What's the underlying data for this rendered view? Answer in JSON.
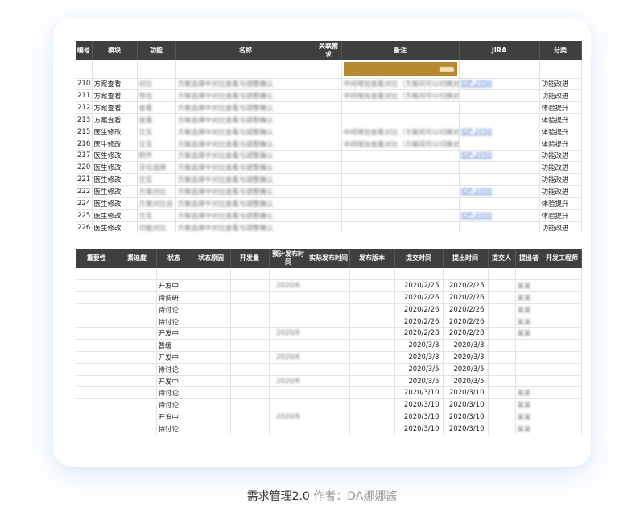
{
  "caption": {
    "title": "需求管理2.0",
    "author": "作者：DA娜娜酱"
  },
  "table1": {
    "headers": [
      "编号",
      "模块",
      "功能",
      "名称",
      "关联需\n求",
      "备注",
      "JIRA",
      "分类"
    ],
    "rows": [
      {
        "id": "210",
        "module": "方案查看",
        "category": "功能改进"
      },
      {
        "id": "211",
        "module": "方案查看",
        "category": "功能改进"
      },
      {
        "id": "212",
        "module": "方案查看",
        "category": "体验提升"
      },
      {
        "id": "213",
        "module": "方案查看",
        "category": "体验提升"
      },
      {
        "id": "215",
        "module": "医生修改",
        "category": "体验提升"
      },
      {
        "id": "216",
        "module": "医生修改",
        "category": "体验提升"
      },
      {
        "id": "217",
        "module": "医生修改",
        "category": "功能改进"
      },
      {
        "id": "220",
        "module": "医生修改",
        "category": "功能改进"
      },
      {
        "id": "221",
        "module": "医生修改",
        "category": "功能改进"
      },
      {
        "id": "222",
        "module": "医生修改",
        "category": "功能改进"
      },
      {
        "id": "224",
        "module": "医生修改",
        "category": "体验提升"
      },
      {
        "id": "225",
        "module": "医生修改",
        "category": "体验提升"
      },
      {
        "id": "226",
        "module": "医生修改",
        "category": "功能改进"
      }
    ]
  },
  "table2": {
    "headers": [
      "重要性",
      "紧迫度",
      "状态",
      "状态原因",
      "开发量",
      "预计发布时间",
      "实际发布时间",
      "发布版本",
      "提交时间",
      "提出时间",
      "提交人",
      "提出者",
      "开发工程师"
    ],
    "rows": [
      {
        "status": "开发中",
        "submit": "2020/2/25",
        "propose": "2020/2/25"
      },
      {
        "status": "待调研",
        "submit": "2020/2/26",
        "propose": "2020/2/26"
      },
      {
        "status": "待讨论",
        "submit": "2020/2/26",
        "propose": "2020/2/26"
      },
      {
        "status": "待讨论",
        "submit": "2020/2/26",
        "propose": "2020/2/26"
      },
      {
        "status": "开发中",
        "submit": "2020/2/28",
        "propose": "2020/2/28"
      },
      {
        "status": "暂缓",
        "submit": "2020/3/3",
        "propose": "2020/3/3"
      },
      {
        "status": "开发中",
        "submit": "2020/3/3",
        "propose": "2020/3/3"
      },
      {
        "status": "待讨论",
        "submit": "2020/3/5",
        "propose": "2020/3/5"
      },
      {
        "status": "开发中",
        "submit": "2020/3/5",
        "propose": "2020/3/5"
      },
      {
        "status": "待讨论",
        "submit": "2020/3/10",
        "propose": "2020/3/10"
      },
      {
        "status": "待讨论",
        "submit": "2020/3/10",
        "propose": "2020/3/10"
      },
      {
        "status": "开发中",
        "submit": "2020/3/10",
        "propose": "2020/3/10"
      },
      {
        "status": "待讨论",
        "submit": "2020/3/10",
        "propose": "2020/3/10"
      }
    ]
  }
}
